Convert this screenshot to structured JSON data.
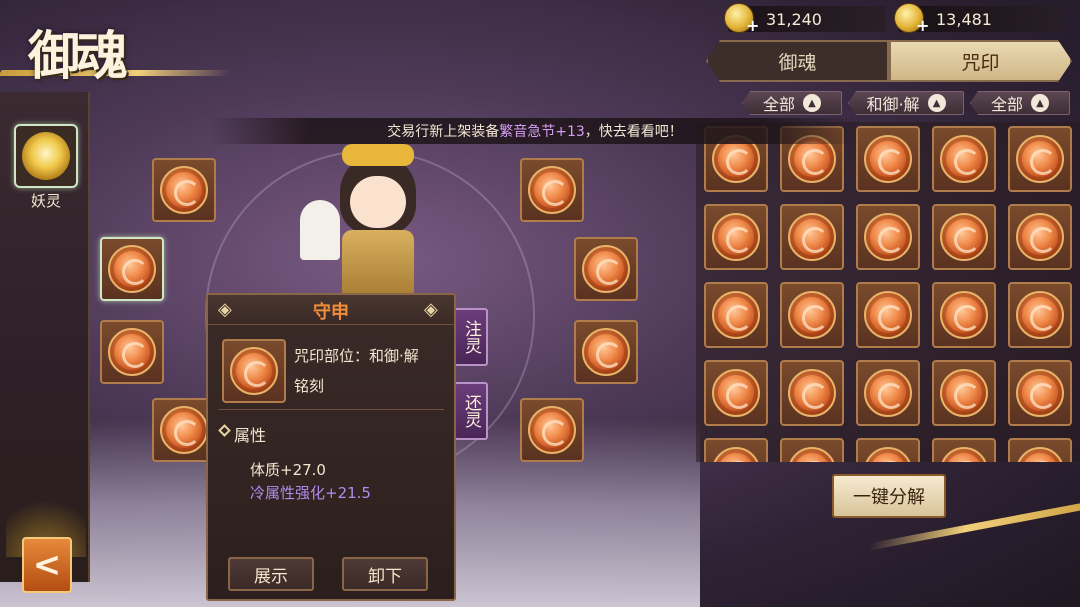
{
  "title": "御魂",
  "currency": [
    {
      "icon": "gold-coin-icon",
      "value": "31,240"
    },
    {
      "icon": "gold-coin-icon",
      "value": "13,481"
    }
  ],
  "tabs": [
    {
      "label": "御魂",
      "active": false
    },
    {
      "label": "咒印",
      "active": true
    }
  ],
  "filters": [
    "全部",
    "和御·解",
    "全部"
  ],
  "marquee": {
    "prefix": "交易行新上架装备",
    "item": "繁音急节+13",
    "suffix": "，快去看看吧！"
  },
  "left_rail": {
    "yaoling_label": "妖灵"
  },
  "side_buttons": [
    "注灵",
    "还灵"
  ],
  "tooltip": {
    "name": "守申",
    "slot_text": "咒印部位：和御·解",
    "engrave": "铭刻",
    "attr_title": "属性",
    "stats": [
      "体质+27.0",
      "冷属性强化+21.5"
    ],
    "buttons": [
      "展示",
      "卸下"
    ]
  },
  "decompose_label": "一键分解",
  "colors": {
    "accent_orange": "#f08e3c",
    "stat_purple": "#b38af0",
    "highlight_purple": "#d59ef2"
  }
}
